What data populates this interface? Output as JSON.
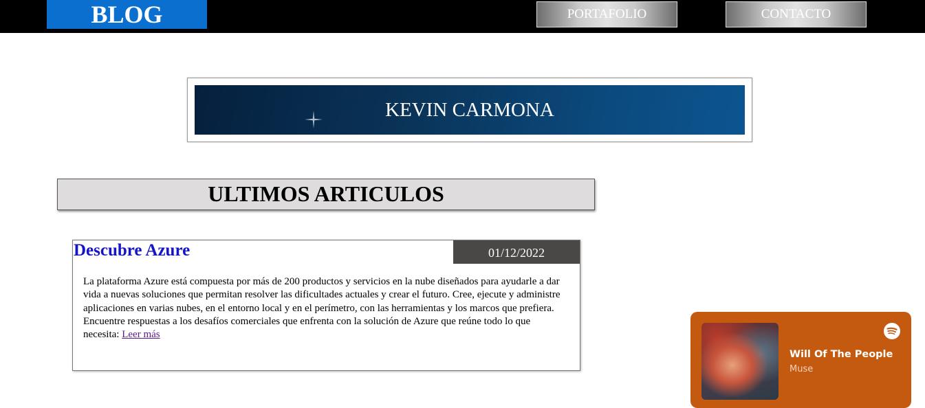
{
  "header": {
    "logo": "BLOG",
    "nav": [
      {
        "label": "PORTAFOLIO"
      },
      {
        "label": "CONTACTO"
      }
    ]
  },
  "banner": {
    "title": "KEVIN CARMONA"
  },
  "section": {
    "heading": "ULTIMOS ARTICULOS"
  },
  "article": {
    "title": "Descubre Azure",
    "date": "01/12/2022",
    "paragraph1": "La plataforma Azure está compuesta por más de 200 productos y servicios en la nube diseñados para ayudarle a dar vida a nuevas soluciones que permitan resolver las dificultades actuales y crear el futuro. Cree, ejecute y administre aplicaciones en varias nubes, en el entorno local y en el perímetro, con las herramientas y los marcos que prefiera.",
    "paragraph2": "Encuentre respuestas a los desafíos comerciales que enfrenta con la solución de Azure que reúne todo lo que necesita:",
    "read_more": "Leer más"
  },
  "player": {
    "track": "Will Of The People",
    "artist": "Muse",
    "icon": "spotify-icon"
  },
  "colors": {
    "logo_bg": "#0b6fcf",
    "article_title": "#1515c8",
    "date_bg": "#4a4747",
    "player_bg": "#c45a10"
  }
}
